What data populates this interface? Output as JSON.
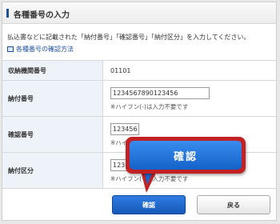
{
  "header": {
    "title": "各種番号の入力"
  },
  "instruction": "払込書などに記載された「納付番号」「確認番号」「納付区分」を入力してください。",
  "help_link": "各種番号の確認方法",
  "form": {
    "rows": [
      {
        "label": "収納機関番号",
        "value": "01101"
      },
      {
        "label": "納付番号",
        "value": "1234567890123456",
        "note": "※ハイフン(-)は入力不要です"
      },
      {
        "label": "確認番号",
        "value": "123456",
        "note": "※ハイフン(-)は入力不要です"
      },
      {
        "label": "納付区分",
        "value": "123",
        "note": "※ハイフン(-)は入力不要です"
      }
    ]
  },
  "buttons": {
    "confirm": "確認",
    "back": "戻る"
  },
  "callout": {
    "label": "確認"
  },
  "colors": {
    "accent": "#1d4f9a",
    "primary_button": "#1a66cf",
    "callout_border": "#c32224",
    "label_bg": "#eef3fa"
  }
}
